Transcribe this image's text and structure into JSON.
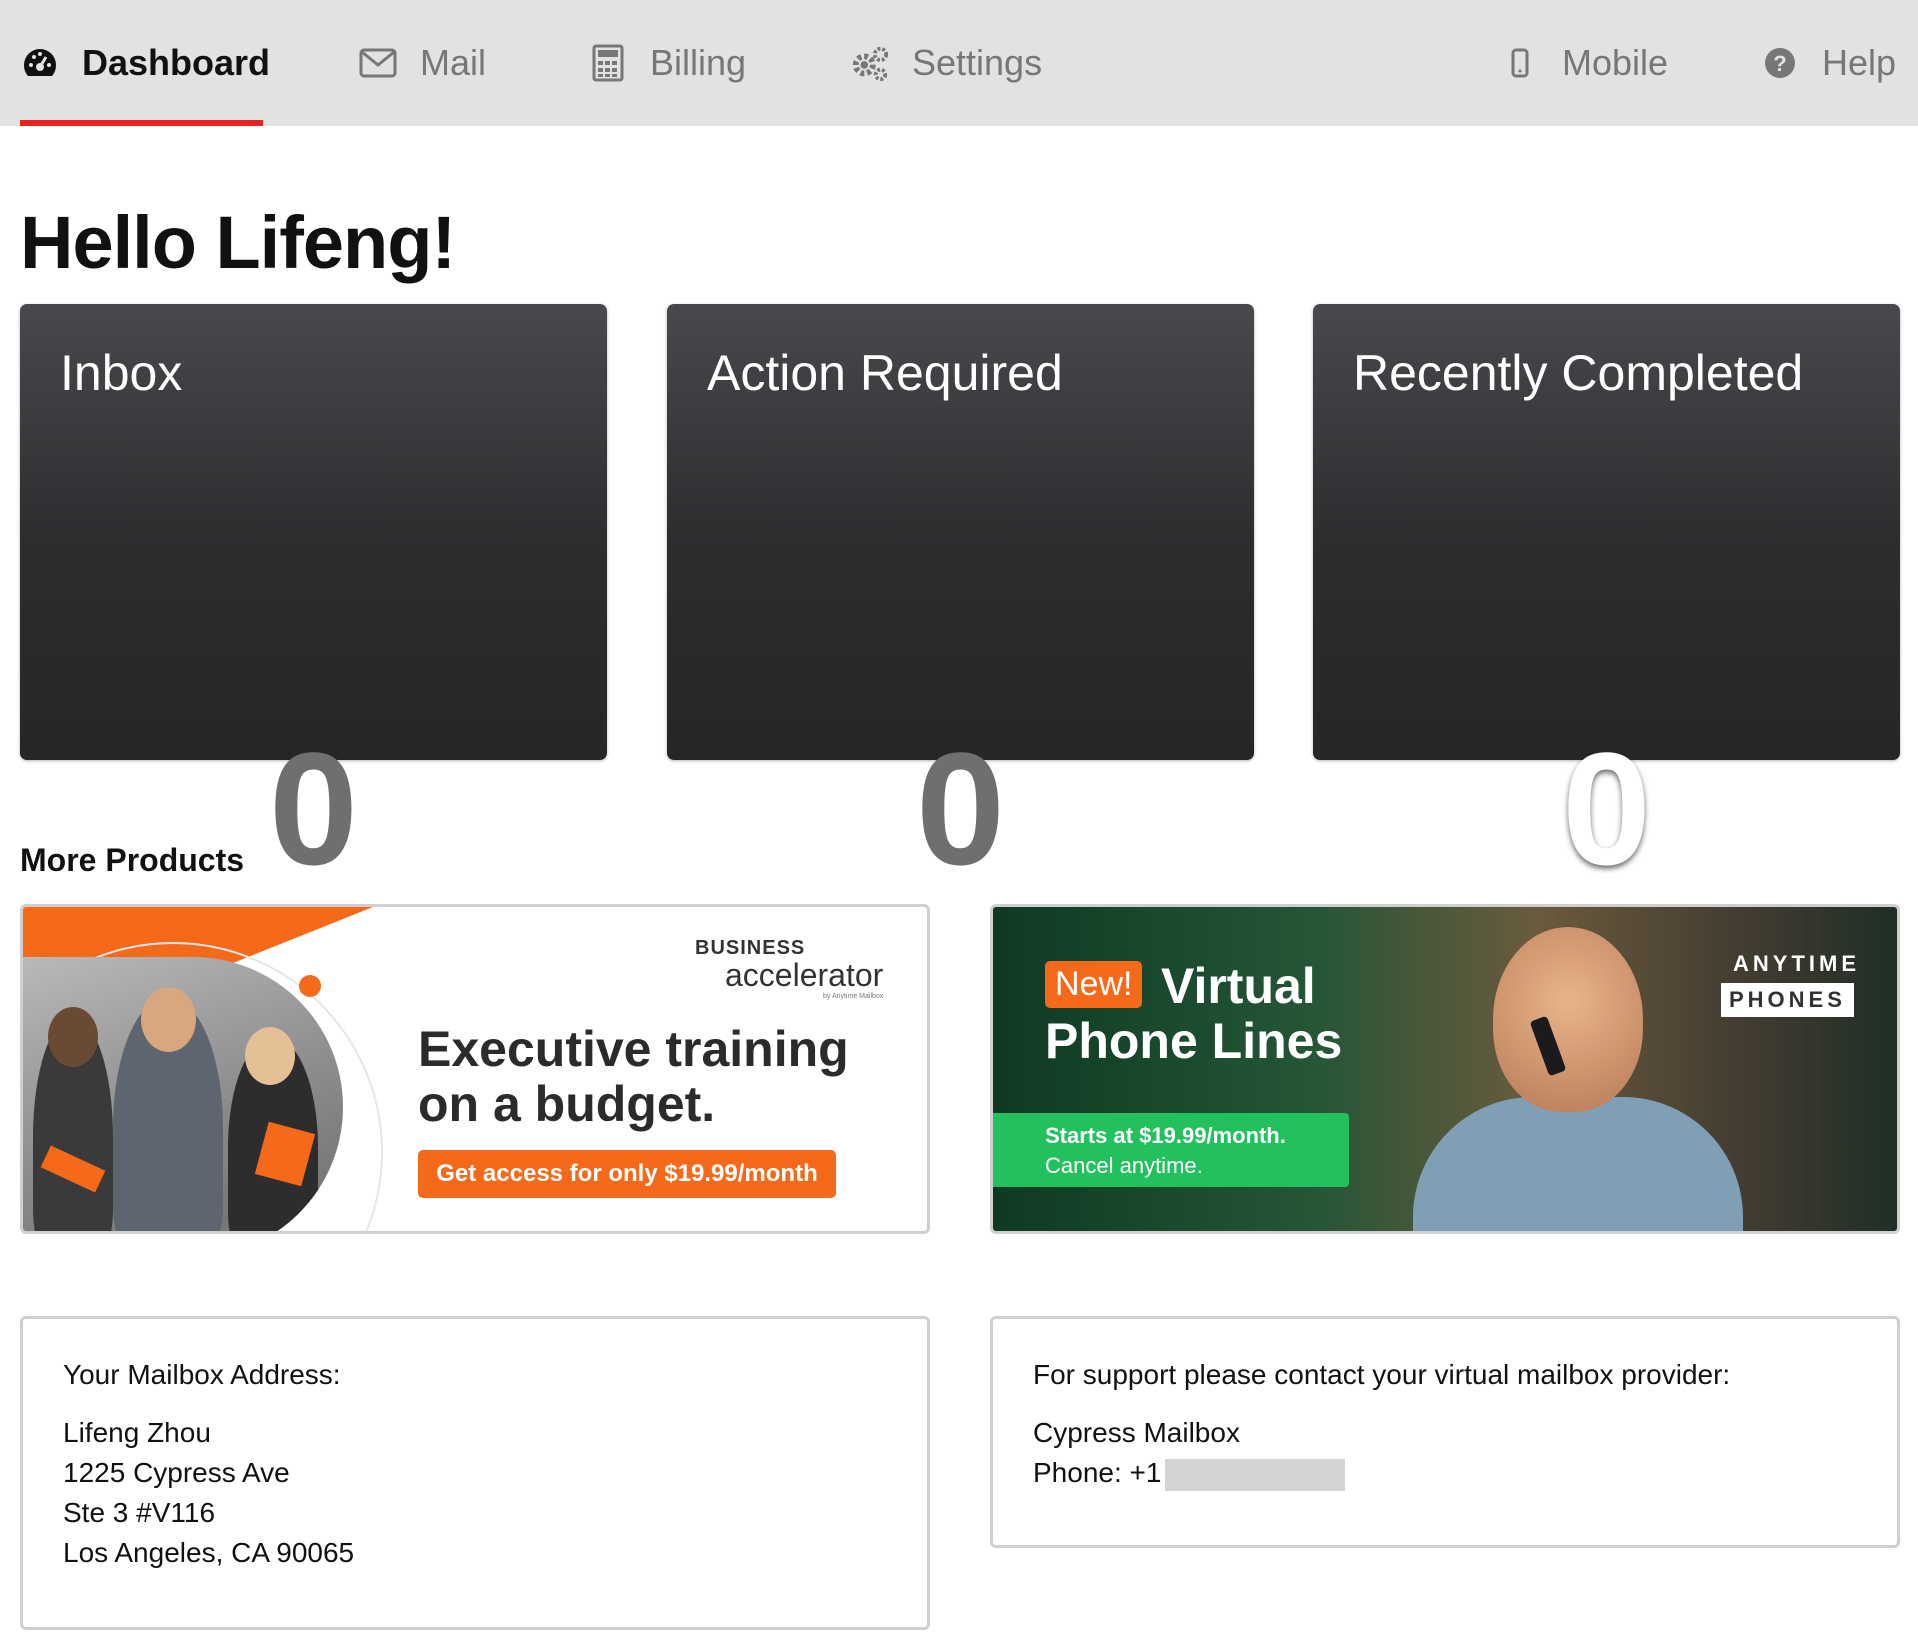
{
  "nav": {
    "items": [
      {
        "label": "Dashboard",
        "icon": "dashboard-gauge-icon",
        "active": true
      },
      {
        "label": "Mail",
        "icon": "envelope-icon",
        "active": false
      },
      {
        "label": "Billing",
        "icon": "calculator-icon",
        "active": false
      },
      {
        "label": "Settings",
        "icon": "gears-icon",
        "active": false
      },
      {
        "label": "Mobile",
        "icon": "mobile-phone-icon",
        "active": false
      },
      {
        "label": "Help",
        "icon": "question-circle-icon",
        "active": false
      }
    ],
    "active_color": "#e8221d"
  },
  "greeting": "Hello Lifeng!",
  "cards": [
    {
      "title": "Inbox",
      "count": "0"
    },
    {
      "title": "Action Required",
      "count": "0"
    },
    {
      "title": "Recently Completed",
      "count": "0"
    }
  ],
  "products": {
    "title": "More Products",
    "accelerator": {
      "brand_top": "BUSINESS",
      "brand_main": "accelerator",
      "brand_sub": "by Anytime Mailbox",
      "headline_line1": "Executive training",
      "headline_line2": "on a budget.",
      "cta": "Get access for only $19.99/month",
      "accent": "#f46a1a"
    },
    "phones": {
      "badge": "New!",
      "title_line1": "Virtual",
      "title_line2": "Phone Lines",
      "price_line1": "Starts at $19.99/month.",
      "price_line2": "Cancel anytime.",
      "brand_line1": "ANYTIME",
      "brand_line2": "PHONES",
      "accent": "#22c15e"
    }
  },
  "mailbox": {
    "label": "Your Mailbox Address:",
    "name": "Lifeng Zhou",
    "street": "1225 Cypress Ave",
    "suite": "Ste 3 #V116",
    "city": "Los Angeles, CA 90065"
  },
  "support": {
    "label": "For support please contact your virtual mailbox provider:",
    "provider": "Cypress Mailbox",
    "phone_prefix": "Phone: +1"
  }
}
